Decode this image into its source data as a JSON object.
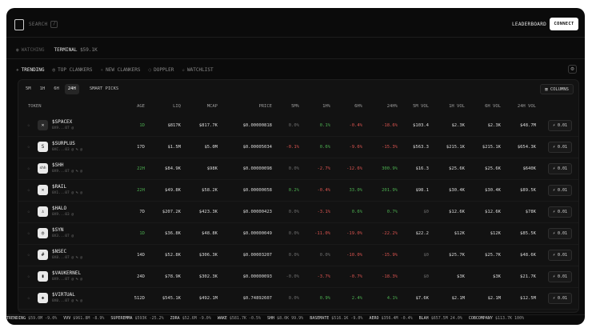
{
  "header": {
    "search_label": "SEARCH",
    "search_kbd": "/",
    "leaderboard_label": "LEADERBOARD",
    "connect_label": "CONNECT"
  },
  "subnav": {
    "watching_label": "WATCHING",
    "terminal_label": "TERMINAL",
    "terminal_value": "$59.1K"
  },
  "tabs": [
    {
      "label": "TRENDING",
      "icon": "sparkle-icon",
      "active": true
    },
    {
      "label": "TOP CLANKERS",
      "icon": "coin-icon",
      "active": false
    },
    {
      "label": "NEW CLANKERS",
      "icon": "sparkle-icon",
      "active": false
    },
    {
      "label": "DOPPLER",
      "icon": "circle-icon",
      "active": false
    },
    {
      "label": "WATCHLIST",
      "icon": "star-icon",
      "active": false
    }
  ],
  "timeframes": [
    {
      "label": "5M",
      "active": false
    },
    {
      "label": "1H",
      "active": false
    },
    {
      "label": "6H",
      "active": false
    },
    {
      "label": "24H",
      "active": true
    }
  ],
  "smart_picks_label": "SMART PICKS",
  "columns_label": "COLUMNS",
  "columns": [
    "TOKEN",
    "AGE",
    "LIQ",
    "MCAP",
    "PRICE",
    "5M%",
    "1H%",
    "6H%",
    "24H%",
    "5M VOL",
    "1H VOL",
    "6H VOL",
    "24H VOL"
  ],
  "rows": [
    {
      "name": "$SPACEX",
      "meta": "0X9...07 @",
      "age": "1D",
      "liq": "$817K",
      "mcap": "$817.7K",
      "price": "$0.00000818",
      "c5m": "0.0%",
      "c1h": "0.1%",
      "c6h": "-0.4%",
      "c24h": "-18.6%",
      "v5m": "$103.4",
      "v1h": "$2.3K",
      "v6h": "$2.3K",
      "v24h": "$48.7M",
      "buy": "0.01",
      "avatar": "✕",
      "dark": true,
      "age_green": true
    },
    {
      "name": "$SURPLUS",
      "meta": "0XC...03 @ % @",
      "age": "17D",
      "liq": "$1.5M",
      "mcap": "$5.0M",
      "price": "$0.00005034",
      "c5m": "-0.1%",
      "c1h": "0.6%",
      "c6h": "-9.6%",
      "c24h": "-15.3%",
      "v5m": "$563.3",
      "v1h": "$215.1K",
      "v6h": "$215.1K",
      "v24h": "$654.3K",
      "buy": "0.01",
      "avatar": "S",
      "dark": false,
      "age_green": false
    },
    {
      "name": "$SHH",
      "meta": "0X9...07 @ % @",
      "age": "22H",
      "liq": "$84.9K",
      "mcap": "$98K",
      "price": "$0.00000098",
      "c5m": "0.0%",
      "c1h": "-2.7%",
      "c6h": "-12.6%",
      "c24h": "300.9%",
      "v5m": "$16.3",
      "v1h": "$25.6K",
      "v6h": "$25.6K",
      "v24h": "$640K",
      "buy": "0.01",
      "avatar": "shh",
      "dark": false,
      "age_green": true
    },
    {
      "name": "$RAIL",
      "meta": "0X1...07 @ % @",
      "age": "22H",
      "liq": "$49.8K",
      "mcap": "$58.2K",
      "price": "$0.00000058",
      "c5m": "0.2%",
      "c1h": "-0.4%",
      "c6h": "33.0%",
      "c24h": "201.9%",
      "v5m": "$98.1",
      "v1h": "$30.4K",
      "v6h": "$30.4K",
      "v24h": "$89.5K",
      "buy": "0.01",
      "avatar": "✕",
      "dark": false,
      "age_green": true
    },
    {
      "name": "$HALO",
      "meta": "0X9...03 @",
      "age": "7D",
      "liq": "$207.2K",
      "mcap": "$423.3K",
      "price": "$0.00000423",
      "c5m": "0.0%",
      "c1h": "-3.1%",
      "c6h": "0.6%",
      "c24h": "0.7%",
      "v5m": "$0",
      "v1h": "$12.6K",
      "v6h": "$12.6K",
      "v24h": "$78K",
      "buy": "0.01",
      "avatar": "♙",
      "dark": false,
      "age_green": false
    },
    {
      "name": "$SYN",
      "meta": "0X3...07 @",
      "age": "1D",
      "liq": "$36.8K",
      "mcap": "$48.8K",
      "price": "$0.00000049",
      "c5m": "0.0%",
      "c1h": "-11.0%",
      "c6h": "-19.0%",
      "c24h": "-22.2%",
      "v5m": "$22.2",
      "v1h": "$12K",
      "v6h": "$12K",
      "v24h": "$85.5K",
      "buy": "0.01",
      "avatar": "◎",
      "dark": false,
      "age_green": true
    },
    {
      "name": "$NSEC",
      "meta": "0X8...07 @ % @",
      "age": "14D",
      "liq": "$52.8K",
      "mcap": "$306.3K",
      "price": "$0.00003207",
      "c5m": "0.0%",
      "c1h": "0.0%",
      "c6h": "-10.0%",
      "c24h": "-15.9%",
      "v5m": "$0",
      "v1h": "$25.7K",
      "v6h": "$25.7K",
      "v24h": "$48.6K",
      "buy": "0.01",
      "avatar": "#",
      "dark": false,
      "age_green": false
    },
    {
      "name": "$VAUKERNEL",
      "meta": "0X9...07 @ % @",
      "age": "24D",
      "liq": "$78.9K",
      "mcap": "$302.3K",
      "price": "$0.00000093",
      "c5m": "-0.0%",
      "c1h": "-3.7%",
      "c6h": "-0.7%",
      "c24h": "-18.3%",
      "v5m": "$0",
      "v1h": "$3K",
      "v6h": "$3K",
      "v24h": "$21.7K",
      "buy": "0.01",
      "avatar": "▮",
      "dark": false,
      "age_green": false
    },
    {
      "name": "$VIRTUAL",
      "meta": "0X0...07 @ % @",
      "age": "512D",
      "liq": "$545.1K",
      "mcap": "$492.1M",
      "price": "$0.74892607",
      "c5m": "0.0%",
      "c1h": "0.9%",
      "c6h": "2.4%",
      "c24h": "4.1%",
      "v5m": "$7.6K",
      "v1h": "$2.1M",
      "v6h": "$2.1M",
      "v24h": "$12.5M",
      "buy": "0.01",
      "avatar": "◈",
      "dark": false,
      "age_green": false
    }
  ],
  "ticker": [
    {
      "sym": "TRENDING",
      "val": "$59.0M -9.0%"
    },
    {
      "sym": "VVV",
      "val": "$961.8M -8.9%"
    },
    {
      "sym": "SUPEREMMA",
      "val": "$593K -25.2%"
    },
    {
      "sym": "ZORA",
      "val": "$52.6M -9.0%"
    },
    {
      "sym": "WAKE",
      "val": "$581.7K -0.5%"
    },
    {
      "sym": "SHH",
      "val": "$8.0K 99.9%"
    },
    {
      "sym": "BASEMATE",
      "val": "$516.1K -9.0%"
    },
    {
      "sym": "AERO",
      "val": "$356.4M -0.4%"
    },
    {
      "sym": "BLAH",
      "val": "$657.5M 24.0%"
    },
    {
      "sym": "COBCOMPANY",
      "val": "$113.7K 100%"
    }
  ]
}
